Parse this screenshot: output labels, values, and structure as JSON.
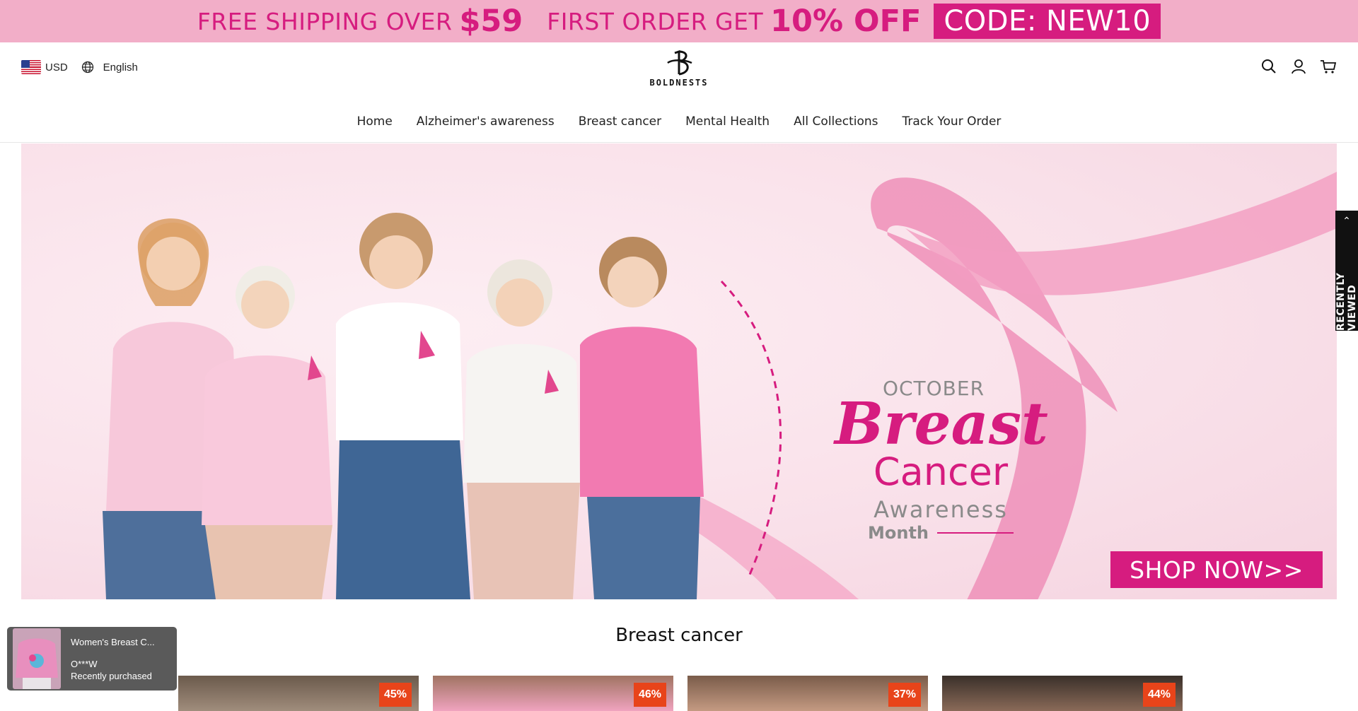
{
  "promo": {
    "part1": "FREE SHIPPING OVER",
    "part2": "$59",
    "part3": "FIRST ORDER GET",
    "part4": "10% OFF",
    "code": "CODE: NEW10",
    "bg_color": "#f2aec8",
    "accent_color": "#d61c7f"
  },
  "header": {
    "currency": "USD",
    "language": "English",
    "logo_text": "BOLDNESTS"
  },
  "nav": {
    "items": [
      {
        "label": "Home"
      },
      {
        "label": "Alzheimer's awareness"
      },
      {
        "label": "Breast cancer"
      },
      {
        "label": "Mental Health"
      },
      {
        "label": "All Collections"
      },
      {
        "label": "Track Your Order"
      }
    ]
  },
  "hero": {
    "october": "OCTOBER",
    "breast": "Breast",
    "cancer": "Cancer",
    "awareness": "Awareness",
    "month": "Month",
    "cta": "SHOP NOW>>"
  },
  "recently_viewed": {
    "label": "RECENTLY VIEWED"
  },
  "section": {
    "title": "Breast cancer"
  },
  "products": [
    {
      "discount": "45%"
    },
    {
      "discount": "46%"
    },
    {
      "discount": "37%"
    },
    {
      "discount": "44%"
    }
  ],
  "popup": {
    "product_name": "Women's Breast C...",
    "buyer": "O***W",
    "status": "Recently purchased"
  },
  "icons": [
    "flag-us-icon",
    "globe-icon",
    "search-icon",
    "account-icon",
    "cart-icon",
    "chevron-up-icon"
  ]
}
